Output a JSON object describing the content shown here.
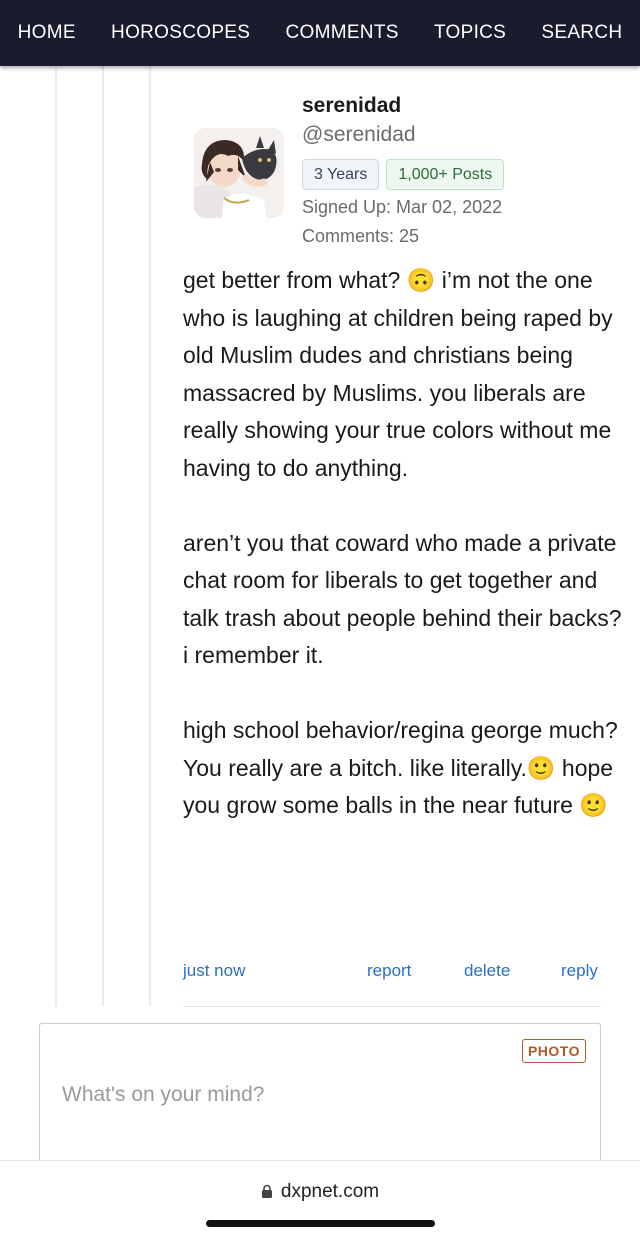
{
  "nav": {
    "items": [
      "HOME",
      "HOROSCOPES",
      "COMMENTS",
      "TOPICS",
      "SEARCH"
    ],
    "background": "#1b1b2e"
  },
  "profile": {
    "username": "serenidad",
    "handle": "@serenidad",
    "badge_years": "3 Years",
    "badge_posts": "1,000+ Posts",
    "signed_up": "Signed Up: Mar 02, 2022",
    "comments": "Comments: 25"
  },
  "comment": {
    "paragraphs": [
      "get better from what? 🙃 i’m not the one who is laughing at children being raped by old Muslim dudes and christians being massacred by Muslims. you liberals are really showing your true colors without me having to do anything.",
      "aren’t you that coward who made a private chat room for liberals to get together and talk trash about people behind their backs? i remember it.",
      "high school behavior/regina george much?\nYou really are a bitch. like literally.🙂 hope you grow some balls in the near future 🙂"
    ],
    "time": "just now",
    "report": "report",
    "delete": "delete",
    "reply": "reply",
    "link_color": "#2b6fc2"
  },
  "composer": {
    "photo_label": "PHOTO",
    "placeholder": "What's on your mind?"
  },
  "browser": {
    "url": "dxpnet.com",
    "lock_icon": "lock-icon"
  }
}
